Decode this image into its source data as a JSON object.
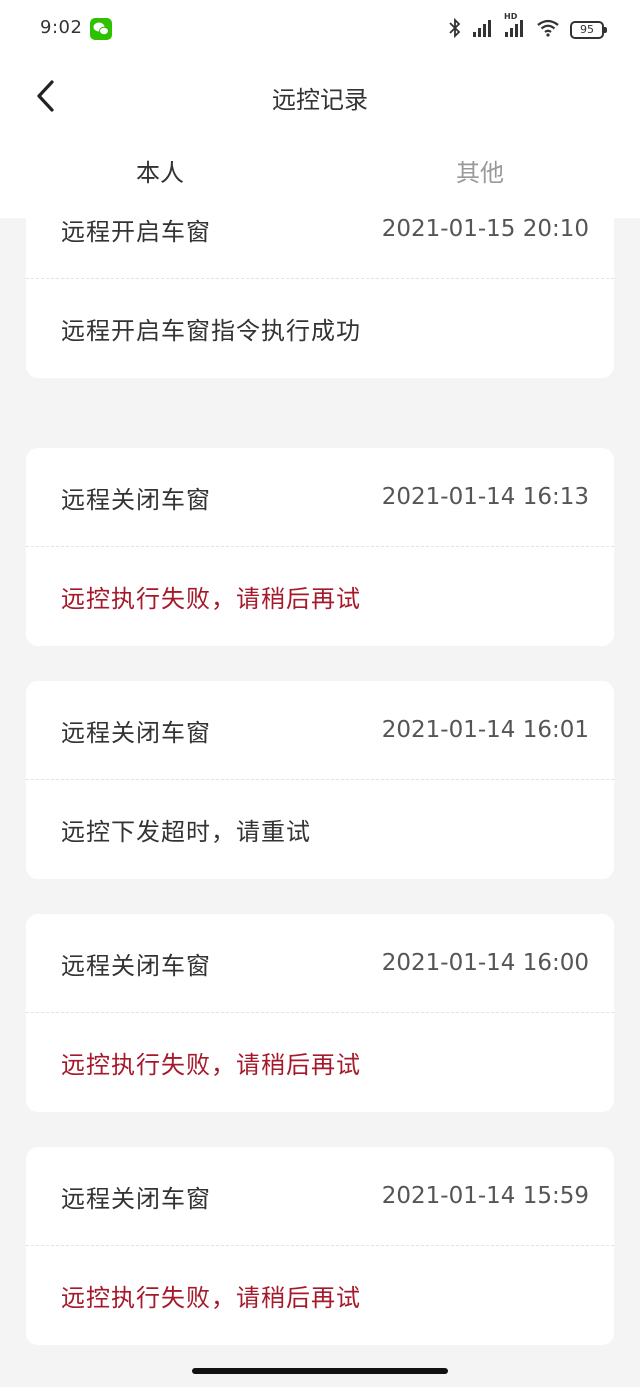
{
  "status_bar": {
    "time": "9:02",
    "battery": "95",
    "network_label": "HD",
    "icons": [
      "wechat-icon",
      "bluetooth-icon",
      "signal-icon",
      "signal-hd-icon",
      "wifi-icon",
      "battery-icon"
    ]
  },
  "header": {
    "title": "远控记录",
    "back_icon": "chevron-left-icon"
  },
  "tabs": [
    {
      "label": "本人",
      "active": true
    },
    {
      "label": "其他",
      "active": false
    }
  ],
  "records": [
    {
      "action": "远程开启车窗",
      "time": "2021-01-15 20:10",
      "result": "远程开启车窗指令执行成功",
      "status": "success"
    },
    {
      "action": "远程关闭车窗",
      "time": "2021-01-14 16:13",
      "result": "远控执行失败，请稍后再试",
      "status": "fail"
    },
    {
      "action": "远程关闭车窗",
      "time": "2021-01-14 16:01",
      "result": "远控下发超时，请重试",
      "status": "neutral"
    },
    {
      "action": "远程关闭车窗",
      "time": "2021-01-14 16:00",
      "result": "远控执行失败，请稍后再试",
      "status": "fail"
    },
    {
      "action": "远程关闭车窗",
      "time": "2021-01-14 15:59",
      "result": "远控执行失败，请稍后再试",
      "status": "fail"
    }
  ],
  "colors": {
    "background": "#f4f4f4",
    "card": "#ffffff",
    "text": "#333333",
    "muted": "#999999",
    "fail": "#a5192a"
  }
}
